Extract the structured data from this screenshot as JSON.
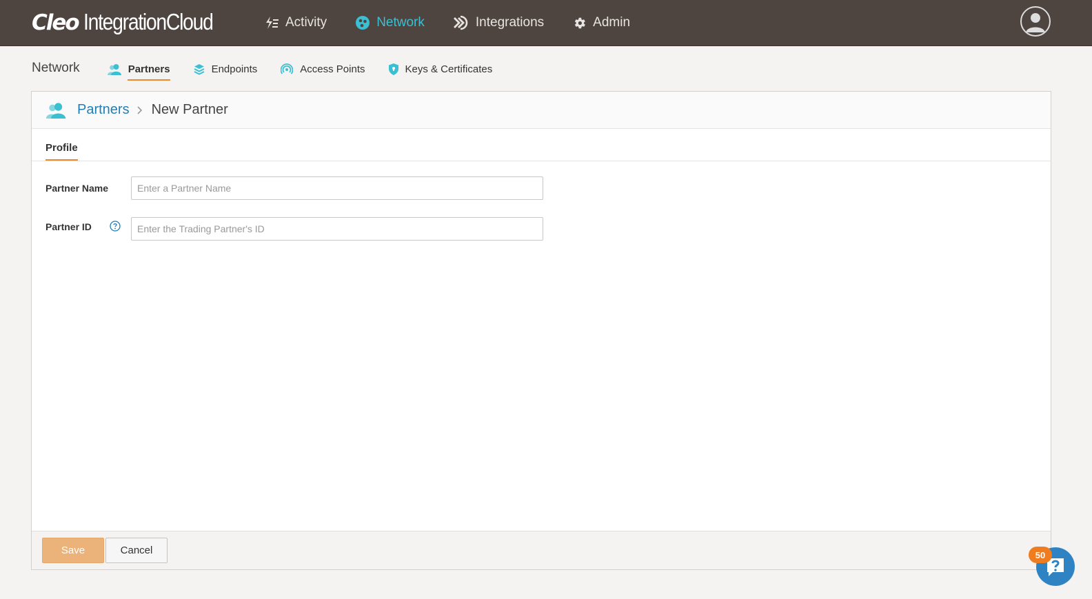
{
  "app": {
    "logo_brand": "Cleo",
    "logo_product": "IntegrationCloud"
  },
  "mainnav": {
    "items": [
      {
        "label": "Activity",
        "icon": "activity-icon"
      },
      {
        "label": "Network",
        "icon": "network-icon",
        "active": true
      },
      {
        "label": "Integrations",
        "icon": "integrations-icon"
      },
      {
        "label": "Admin",
        "icon": "gear-icon"
      }
    ]
  },
  "subnav": {
    "title": "Network",
    "tabs": [
      {
        "label": "Partners",
        "icon": "partners-icon",
        "active": true
      },
      {
        "label": "Endpoints",
        "icon": "layers-icon"
      },
      {
        "label": "Access Points",
        "icon": "signal-icon"
      },
      {
        "label": "Keys & Certificates",
        "icon": "shield-icon"
      }
    ]
  },
  "breadcrumb": {
    "parent": "Partners",
    "current": "New Partner"
  },
  "profile_tab": "Profile",
  "form": {
    "partner_name": {
      "label": "Partner Name",
      "placeholder": "Enter a Partner Name",
      "value": ""
    },
    "partner_id": {
      "label": "Partner ID",
      "placeholder": "Enter the Trading Partner's ID",
      "value": ""
    }
  },
  "footer": {
    "save_label": "Save",
    "cancel_label": "Cancel"
  },
  "help": {
    "badge_count": "50"
  },
  "colors": {
    "topbar": "#4e4540",
    "accent_teal": "#3bbfd2",
    "accent_orange": "#e88a2f",
    "link_blue": "#1f7fb5",
    "save_button": "#ebb27a"
  }
}
